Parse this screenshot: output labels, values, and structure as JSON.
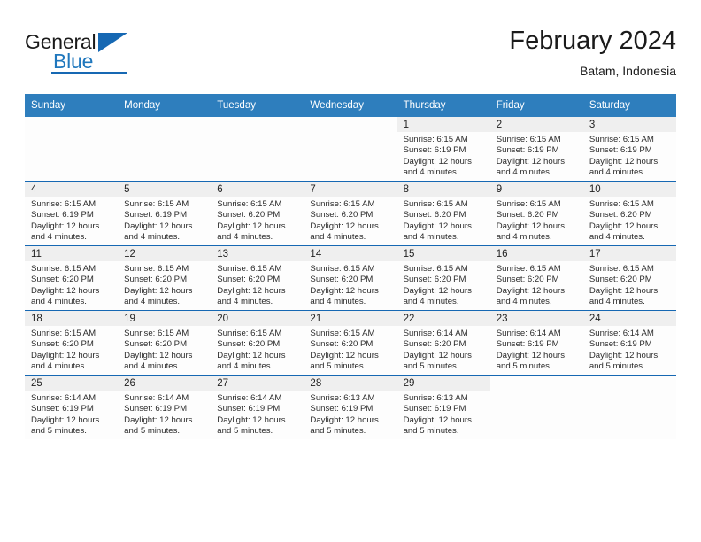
{
  "brand": {
    "name_part1": "General",
    "name_part2": "Blue",
    "logo_icon": "triangle-logo"
  },
  "header": {
    "month_title": "February 2024",
    "location": "Batam, Indonesia"
  },
  "colors": {
    "header_blue": "#2e7ebd",
    "rule_blue": "#1668b3",
    "daynum_band": "#efefef",
    "brand_blue": "#1f77bd"
  },
  "weekday_headers": [
    "Sunday",
    "Monday",
    "Tuesday",
    "Wednesday",
    "Thursday",
    "Friday",
    "Saturday"
  ],
  "weeks": [
    [
      {
        "day": "",
        "sunrise": "",
        "sunset": "",
        "daylight1": "",
        "daylight2": ""
      },
      {
        "day": "",
        "sunrise": "",
        "sunset": "",
        "daylight1": "",
        "daylight2": ""
      },
      {
        "day": "",
        "sunrise": "",
        "sunset": "",
        "daylight1": "",
        "daylight2": ""
      },
      {
        "day": "",
        "sunrise": "",
        "sunset": "",
        "daylight1": "",
        "daylight2": ""
      },
      {
        "day": "1",
        "sunrise": "Sunrise: 6:15 AM",
        "sunset": "Sunset: 6:19 PM",
        "daylight1": "Daylight: 12 hours",
        "daylight2": "and 4 minutes."
      },
      {
        "day": "2",
        "sunrise": "Sunrise: 6:15 AM",
        "sunset": "Sunset: 6:19 PM",
        "daylight1": "Daylight: 12 hours",
        "daylight2": "and 4 minutes."
      },
      {
        "day": "3",
        "sunrise": "Sunrise: 6:15 AM",
        "sunset": "Sunset: 6:19 PM",
        "daylight1": "Daylight: 12 hours",
        "daylight2": "and 4 minutes."
      }
    ],
    [
      {
        "day": "4",
        "sunrise": "Sunrise: 6:15 AM",
        "sunset": "Sunset: 6:19 PM",
        "daylight1": "Daylight: 12 hours",
        "daylight2": "and 4 minutes."
      },
      {
        "day": "5",
        "sunrise": "Sunrise: 6:15 AM",
        "sunset": "Sunset: 6:19 PM",
        "daylight1": "Daylight: 12 hours",
        "daylight2": "and 4 minutes."
      },
      {
        "day": "6",
        "sunrise": "Sunrise: 6:15 AM",
        "sunset": "Sunset: 6:20 PM",
        "daylight1": "Daylight: 12 hours",
        "daylight2": "and 4 minutes."
      },
      {
        "day": "7",
        "sunrise": "Sunrise: 6:15 AM",
        "sunset": "Sunset: 6:20 PM",
        "daylight1": "Daylight: 12 hours",
        "daylight2": "and 4 minutes."
      },
      {
        "day": "8",
        "sunrise": "Sunrise: 6:15 AM",
        "sunset": "Sunset: 6:20 PM",
        "daylight1": "Daylight: 12 hours",
        "daylight2": "and 4 minutes."
      },
      {
        "day": "9",
        "sunrise": "Sunrise: 6:15 AM",
        "sunset": "Sunset: 6:20 PM",
        "daylight1": "Daylight: 12 hours",
        "daylight2": "and 4 minutes."
      },
      {
        "day": "10",
        "sunrise": "Sunrise: 6:15 AM",
        "sunset": "Sunset: 6:20 PM",
        "daylight1": "Daylight: 12 hours",
        "daylight2": "and 4 minutes."
      }
    ],
    [
      {
        "day": "11",
        "sunrise": "Sunrise: 6:15 AM",
        "sunset": "Sunset: 6:20 PM",
        "daylight1": "Daylight: 12 hours",
        "daylight2": "and 4 minutes."
      },
      {
        "day": "12",
        "sunrise": "Sunrise: 6:15 AM",
        "sunset": "Sunset: 6:20 PM",
        "daylight1": "Daylight: 12 hours",
        "daylight2": "and 4 minutes."
      },
      {
        "day": "13",
        "sunrise": "Sunrise: 6:15 AM",
        "sunset": "Sunset: 6:20 PM",
        "daylight1": "Daylight: 12 hours",
        "daylight2": "and 4 minutes."
      },
      {
        "day": "14",
        "sunrise": "Sunrise: 6:15 AM",
        "sunset": "Sunset: 6:20 PM",
        "daylight1": "Daylight: 12 hours",
        "daylight2": "and 4 minutes."
      },
      {
        "day": "15",
        "sunrise": "Sunrise: 6:15 AM",
        "sunset": "Sunset: 6:20 PM",
        "daylight1": "Daylight: 12 hours",
        "daylight2": "and 4 minutes."
      },
      {
        "day": "16",
        "sunrise": "Sunrise: 6:15 AM",
        "sunset": "Sunset: 6:20 PM",
        "daylight1": "Daylight: 12 hours",
        "daylight2": "and 4 minutes."
      },
      {
        "day": "17",
        "sunrise": "Sunrise: 6:15 AM",
        "sunset": "Sunset: 6:20 PM",
        "daylight1": "Daylight: 12 hours",
        "daylight2": "and 4 minutes."
      }
    ],
    [
      {
        "day": "18",
        "sunrise": "Sunrise: 6:15 AM",
        "sunset": "Sunset: 6:20 PM",
        "daylight1": "Daylight: 12 hours",
        "daylight2": "and 4 minutes."
      },
      {
        "day": "19",
        "sunrise": "Sunrise: 6:15 AM",
        "sunset": "Sunset: 6:20 PM",
        "daylight1": "Daylight: 12 hours",
        "daylight2": "and 4 minutes."
      },
      {
        "day": "20",
        "sunrise": "Sunrise: 6:15 AM",
        "sunset": "Sunset: 6:20 PM",
        "daylight1": "Daylight: 12 hours",
        "daylight2": "and 4 minutes."
      },
      {
        "day": "21",
        "sunrise": "Sunrise: 6:15 AM",
        "sunset": "Sunset: 6:20 PM",
        "daylight1": "Daylight: 12 hours",
        "daylight2": "and 5 minutes."
      },
      {
        "day": "22",
        "sunrise": "Sunrise: 6:14 AM",
        "sunset": "Sunset: 6:20 PM",
        "daylight1": "Daylight: 12 hours",
        "daylight2": "and 5 minutes."
      },
      {
        "day": "23",
        "sunrise": "Sunrise: 6:14 AM",
        "sunset": "Sunset: 6:19 PM",
        "daylight1": "Daylight: 12 hours",
        "daylight2": "and 5 minutes."
      },
      {
        "day": "24",
        "sunrise": "Sunrise: 6:14 AM",
        "sunset": "Sunset: 6:19 PM",
        "daylight1": "Daylight: 12 hours",
        "daylight2": "and 5 minutes."
      }
    ],
    [
      {
        "day": "25",
        "sunrise": "Sunrise: 6:14 AM",
        "sunset": "Sunset: 6:19 PM",
        "daylight1": "Daylight: 12 hours",
        "daylight2": "and 5 minutes."
      },
      {
        "day": "26",
        "sunrise": "Sunrise: 6:14 AM",
        "sunset": "Sunset: 6:19 PM",
        "daylight1": "Daylight: 12 hours",
        "daylight2": "and 5 minutes."
      },
      {
        "day": "27",
        "sunrise": "Sunrise: 6:14 AM",
        "sunset": "Sunset: 6:19 PM",
        "daylight1": "Daylight: 12 hours",
        "daylight2": "and 5 minutes."
      },
      {
        "day": "28",
        "sunrise": "Sunrise: 6:13 AM",
        "sunset": "Sunset: 6:19 PM",
        "daylight1": "Daylight: 12 hours",
        "daylight2": "and 5 minutes."
      },
      {
        "day": "29",
        "sunrise": "Sunrise: 6:13 AM",
        "sunset": "Sunset: 6:19 PM",
        "daylight1": "Daylight: 12 hours",
        "daylight2": "and 5 minutes."
      },
      {
        "day": "",
        "sunrise": "",
        "sunset": "",
        "daylight1": "",
        "daylight2": ""
      },
      {
        "day": "",
        "sunrise": "",
        "sunset": "",
        "daylight1": "",
        "daylight2": ""
      }
    ]
  ]
}
